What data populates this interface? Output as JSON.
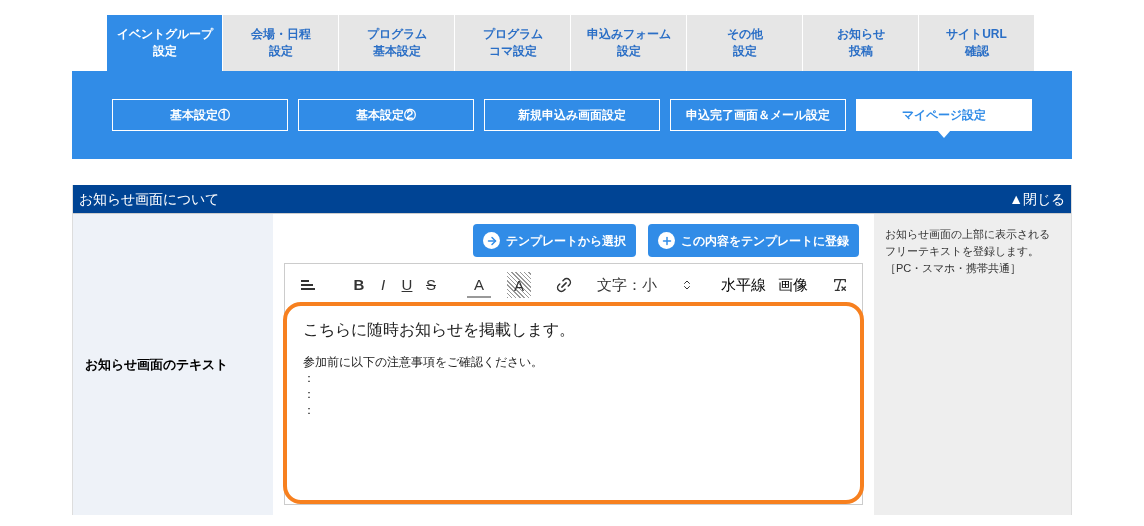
{
  "main_tabs": [
    {
      "lines": [
        "イベントグループ",
        "設定"
      ],
      "selected": true
    },
    {
      "lines": [
        "会場・日程",
        "設定"
      ],
      "selected": false
    },
    {
      "lines": [
        "プログラム",
        "基本設定"
      ],
      "selected": false
    },
    {
      "lines": [
        "プログラム",
        "コマ設定"
      ],
      "selected": false
    },
    {
      "lines": [
        "申込みフォーム",
        "設定"
      ],
      "selected": false
    },
    {
      "lines": [
        "その他",
        "設定"
      ],
      "selected": false
    },
    {
      "lines": [
        "お知らせ",
        "投稿"
      ],
      "selected": false
    },
    {
      "lines": [
        "サイトURL",
        "確認"
      ],
      "selected": false
    }
  ],
  "sub_tabs": [
    {
      "label": "基本設定①",
      "selected": false
    },
    {
      "label": "基本設定②",
      "selected": false
    },
    {
      "label": "新規申込み画面設定",
      "selected": false
    },
    {
      "label": "申込完了画面＆メール設定",
      "selected": false
    },
    {
      "label": "マイページ設定",
      "selected": true
    }
  ],
  "section": {
    "title": "お知らせ画面について",
    "toggle": "▲閉じる",
    "expanded": true,
    "row": {
      "label": "お知らせ画面のテキスト",
      "buttons": [
        {
          "kind": "select",
          "label": "テンプレートから選択"
        },
        {
          "kind": "add",
          "label": "この内容をテンプレートに登録"
        }
      ],
      "toolbar": [
        {
          "kind": "align"
        },
        {
          "kind": "bold",
          "label": "B"
        },
        {
          "kind": "italic",
          "label": "I"
        },
        {
          "kind": "underline",
          "label": "U"
        },
        {
          "kind": "strike",
          "label": "S"
        },
        {
          "kind": "color",
          "label": "A"
        },
        {
          "kind": "highlight",
          "label": "A"
        },
        {
          "kind": "link"
        },
        {
          "kind": "select",
          "label": "文字：小"
        },
        {
          "kind": "text",
          "label": "水平線"
        },
        {
          "kind": "text",
          "label": "画像"
        },
        {
          "kind": "clear"
        }
      ],
      "editor": {
        "heading": "こちらに随時お知らせを掲載します。",
        "lines": [
          "参加前に以下の注意事項をご確認ください。",
          "：",
          "：",
          "："
        ],
        "highlighted": true
      },
      "help": [
        "お知らせ画面の上部に表示される",
        "フリーテキストを登録します。",
        "［PC・スマホ・携帯共通］"
      ]
    }
  }
}
